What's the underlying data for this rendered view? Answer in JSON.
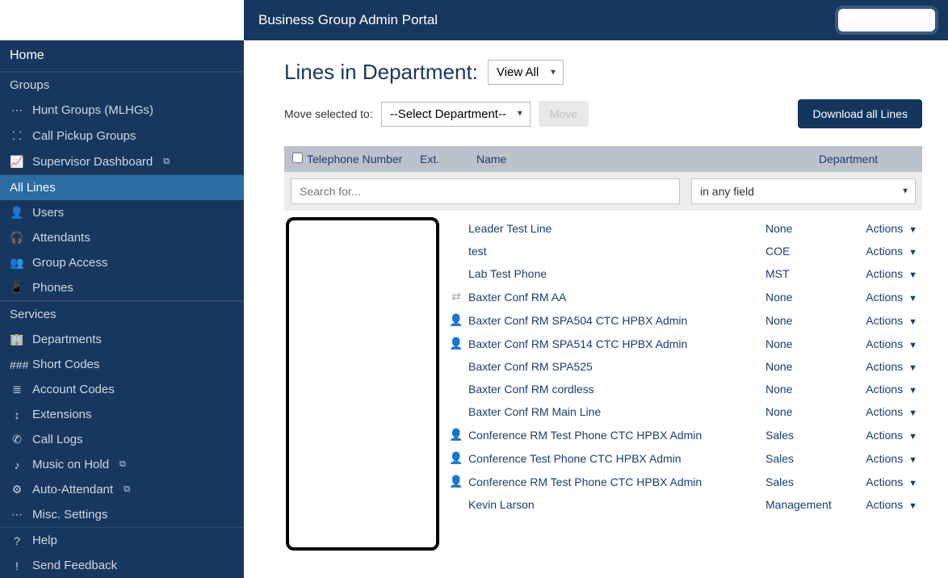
{
  "header": {
    "title": "Business Group Admin Portal"
  },
  "sidebar": {
    "home": "Home",
    "groups_header": "Groups",
    "groups": [
      {
        "icon": "⋯",
        "label": "Hunt Groups (MLHGs)"
      },
      {
        "icon": "⸬",
        "label": "Call Pickup Groups"
      },
      {
        "icon": "📈",
        "label": "Supervisor Dashboard",
        "external": true
      }
    ],
    "all_lines": {
      "label": "All Lines"
    },
    "lines_items": [
      {
        "icon": "👤",
        "label": "Users"
      },
      {
        "icon": "🎧",
        "label": "Attendants"
      },
      {
        "icon": "👥",
        "label": "Group Access"
      },
      {
        "icon": "📱",
        "label": "Phones"
      }
    ],
    "services_header": "Services",
    "services": [
      {
        "icon": "🏢",
        "label": "Departments"
      },
      {
        "icon": "###",
        "label": "Short Codes"
      },
      {
        "icon": "≣",
        "label": "Account Codes"
      },
      {
        "icon": "↕",
        "label": "Extensions"
      },
      {
        "icon": "✆",
        "label": "Call Logs"
      },
      {
        "icon": "♪",
        "label": "Music on Hold",
        "external": true
      },
      {
        "icon": "⚙",
        "label": "Auto-Attendant",
        "external": true
      },
      {
        "icon": "⋯",
        "label": "Misc. Settings"
      }
    ],
    "footer": [
      {
        "icon": "?",
        "label": "Help"
      },
      {
        "icon": "!",
        "label": "Send Feedback"
      }
    ]
  },
  "main": {
    "title": "Lines in Department:",
    "view_select": "View All",
    "move_label": "Move selected to:",
    "dept_select": "--Select Department--",
    "move_btn": "Move",
    "download_btn": "Download all Lines",
    "columns": {
      "tel": "Telephone Number",
      "ext": "Ext.",
      "name": "Name",
      "dept": "Department"
    },
    "search_placeholder": "Search for...",
    "field_select": "in any field",
    "actions_label": "Actions",
    "rows": [
      {
        "icon": "",
        "name": "Leader Test Line",
        "dept": "None"
      },
      {
        "icon": "",
        "name": "test",
        "dept": "COE"
      },
      {
        "icon": "",
        "name": "Lab Test Phone",
        "dept": "MST"
      },
      {
        "icon": "⇄",
        "name": "Baxter Conf RM AA",
        "dept": "None"
      },
      {
        "icon": "👤",
        "name": "Baxter Conf RM SPA504 CTC HPBX Admin",
        "dept": "None"
      },
      {
        "icon": "👤",
        "name": "Baxter Conf RM SPA514 CTC HPBX Admin",
        "dept": "None"
      },
      {
        "icon": "",
        "name": "Baxter Conf RM SPA525",
        "dept": "None"
      },
      {
        "icon": "",
        "name": "Baxter Conf RM cordless",
        "dept": "None"
      },
      {
        "icon": "",
        "name": "Baxter Conf RM Main Line",
        "dept": "None"
      },
      {
        "icon": "👤",
        "name": "Conference RM Test Phone CTC HPBX Admin",
        "dept": "Sales"
      },
      {
        "icon": "👤",
        "name": "Conference Test Phone CTC HPBX Admin",
        "dept": "Sales"
      },
      {
        "icon": "👤",
        "name": "Conference RM Test Phone CTC HPBX Admin",
        "dept": "Sales"
      },
      {
        "icon": "",
        "name": "Kevin Larson",
        "dept": "Management"
      }
    ]
  }
}
